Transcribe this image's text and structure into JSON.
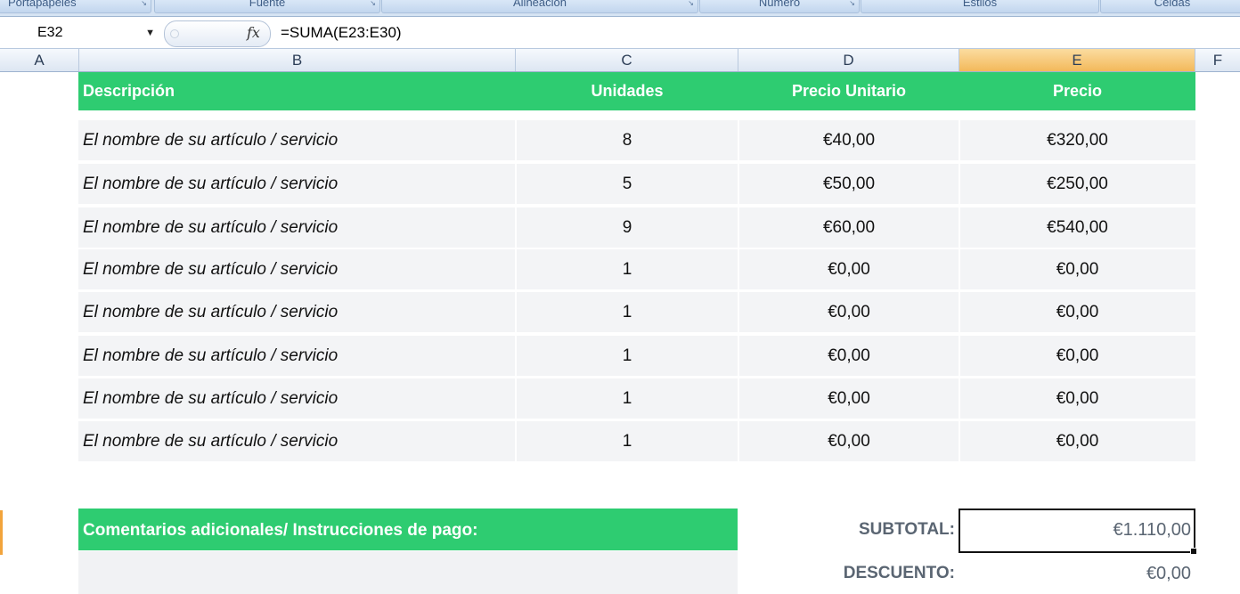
{
  "ribbon": {
    "groups": [
      "Portapapeles",
      "Fuente",
      "Alineación",
      "Número",
      "Estilos",
      "Celdas"
    ]
  },
  "formula_bar": {
    "name_box": "E32",
    "fx_icon": "fx-icon",
    "formula": "=SUMA(E23:E30)"
  },
  "columns": [
    "A",
    "B",
    "C",
    "D",
    "E",
    "F"
  ],
  "selected_column": "E",
  "table": {
    "headers": {
      "description": "Descripción",
      "units": "Unidades",
      "unit_price": "Precio Unitario",
      "price": "Precio"
    },
    "rows": [
      {
        "description": "El nombre de su artículo / servicio",
        "units": "8",
        "unit_price": "€40,00",
        "price": "€320,00"
      },
      {
        "description": "El nombre de su artículo / servicio",
        "units": "5",
        "unit_price": "€50,00",
        "price": "€250,00"
      },
      {
        "description": "El nombre de su artículo / servicio",
        "units": "9",
        "unit_price": "€60,00",
        "price": "€540,00"
      },
      {
        "description": "El nombre de su artículo / servicio",
        "units": "1",
        "unit_price": "€0,00",
        "price": "€0,00"
      },
      {
        "description": "El nombre de su artículo / servicio",
        "units": "1",
        "unit_price": "€0,00",
        "price": "€0,00"
      },
      {
        "description": "El nombre de su artículo / servicio",
        "units": "1",
        "unit_price": "€0,00",
        "price": "€0,00"
      },
      {
        "description": "El nombre de su artículo / servicio",
        "units": "1",
        "unit_price": "€0,00",
        "price": "€0,00"
      },
      {
        "description": "El nombre de su artículo / servicio",
        "units": "1",
        "unit_price": "€0,00",
        "price": "€0,00"
      }
    ]
  },
  "comments": {
    "title": "Comentarios adicionales/ Instrucciones de pago:"
  },
  "totals": {
    "subtotal_label": "SUBTOTAL:",
    "subtotal_value": "€1.110,00",
    "discount_label": "DESCUENTO:",
    "discount_value": "€0,00"
  },
  "colors": {
    "header_green": "#2ecc71",
    "row_gray": "#f3f4f6",
    "selected_column": "#f3b95a"
  }
}
